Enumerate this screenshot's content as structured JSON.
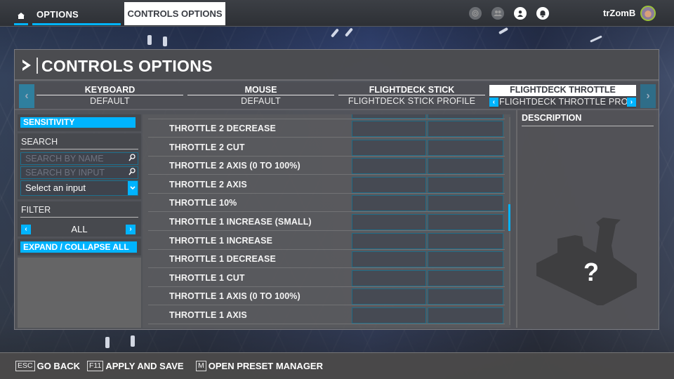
{
  "topbar": {
    "home_icon": "home-icon",
    "tabs": [
      {
        "label": "OPTIONS"
      },
      {
        "label": "CONTROLS OPTIONS"
      }
    ],
    "icons": [
      "activity-icon",
      "friends-icon",
      "profile-icon",
      "notifications-icon"
    ],
    "username": "trZomB"
  },
  "header": {
    "title": "CONTROLS OPTIONS"
  },
  "devices": [
    {
      "name": "KEYBOARD",
      "profile": "DEFAULT"
    },
    {
      "name": "MOUSE",
      "profile": "DEFAULT"
    },
    {
      "name": "FLIGHTDECK STICK",
      "profile": "FLIGHTDECK STICK PROFILE"
    },
    {
      "name": "FLIGHTDECK THROTTLE",
      "profile": "FLIGHTDECK THROTTLE PROFILE",
      "active": true
    }
  ],
  "sidebar": {
    "sensitivity_label": "SENSITIVITY",
    "search_label": "SEARCH",
    "search_by_name_placeholder": "SEARCH BY NAME",
    "search_by_input_placeholder": "SEARCH BY INPUT",
    "select_input_value": "Select an input",
    "filter_label": "FILTER",
    "filter_value": "ALL",
    "expand_collapse_label": "EXPAND / COLLAPSE ALL"
  },
  "bindings": [
    {
      "label": "THROTTLE 2 DECREASE",
      "input1": "",
      "input2": ""
    },
    {
      "label": "THROTTLE 2 CUT",
      "input1": "",
      "input2": ""
    },
    {
      "label": "THROTTLE 2 AXIS (0 TO 100%)",
      "input1": "",
      "input2": ""
    },
    {
      "label": "THROTTLE 2 AXIS",
      "input1": "",
      "input2": ""
    },
    {
      "label": "THROTTLE 10%",
      "input1": "",
      "input2": ""
    },
    {
      "label": "THROTTLE 1 INCREASE (SMALL)",
      "input1": "",
      "input2": ""
    },
    {
      "label": "THROTTLE 1 INCREASE",
      "input1": "",
      "input2": ""
    },
    {
      "label": "THROTTLE 1 DECREASE",
      "input1": "",
      "input2": ""
    },
    {
      "label": "THROTTLE 1 CUT",
      "input1": "",
      "input2": ""
    },
    {
      "label": "THROTTLE 1 AXIS (0 TO 100%)",
      "input1": "",
      "input2": ""
    },
    {
      "label": "THROTTLE 1 AXIS",
      "input1": "",
      "input2": ""
    }
  ],
  "list_scroll_fraction": 0.48,
  "description": {
    "title": "DESCRIPTION",
    "placeholder_glyph": "?"
  },
  "footer": {
    "hints": [
      {
        "key": "ESC",
        "label": "GO BACK"
      },
      {
        "key": "F11",
        "label": "APPLY AND SAVE"
      },
      {
        "key": "M",
        "label": "OPEN PRESET MANAGER"
      }
    ]
  },
  "colors": {
    "accent": "#00b4ff",
    "slot_border": "#1f6b86",
    "slot_bg": "#464a53"
  }
}
